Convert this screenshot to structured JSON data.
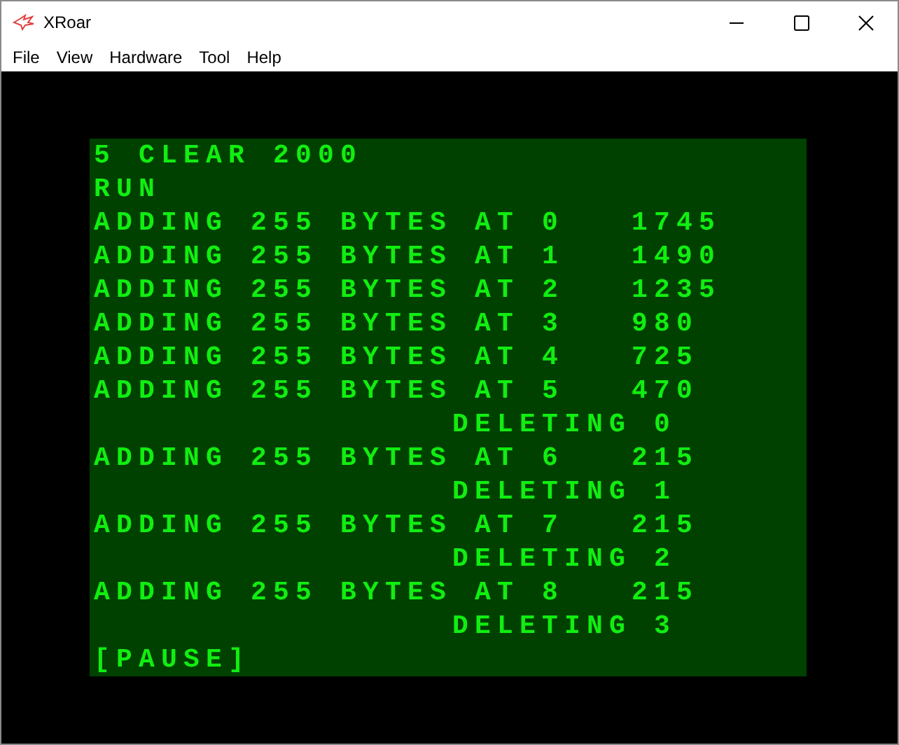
{
  "window": {
    "title": "XRoar"
  },
  "menu": [
    "File",
    "View",
    "Hardware",
    "Tool",
    "Help"
  ],
  "screen_lines": [
    "5 CLEAR 2000",
    "RUN",
    "ADDING 255 BYTES AT 0   1745",
    "ADDING 255 BYTES AT 1   1490",
    "ADDING 255 BYTES AT 2   1235",
    "ADDING 255 BYTES AT 3   980",
    "ADDING 255 BYTES AT 4   725",
    "ADDING 255 BYTES AT 5   470",
    "                DELETING 0",
    "ADDING 255 BYTES AT 6   215",
    "                DELETING 1",
    "ADDING 255 BYTES AT 7   215",
    "                DELETING 2",
    "ADDING 255 BYTES AT 8   215",
    "                DELETING 3",
    "[PAUSE]"
  ]
}
